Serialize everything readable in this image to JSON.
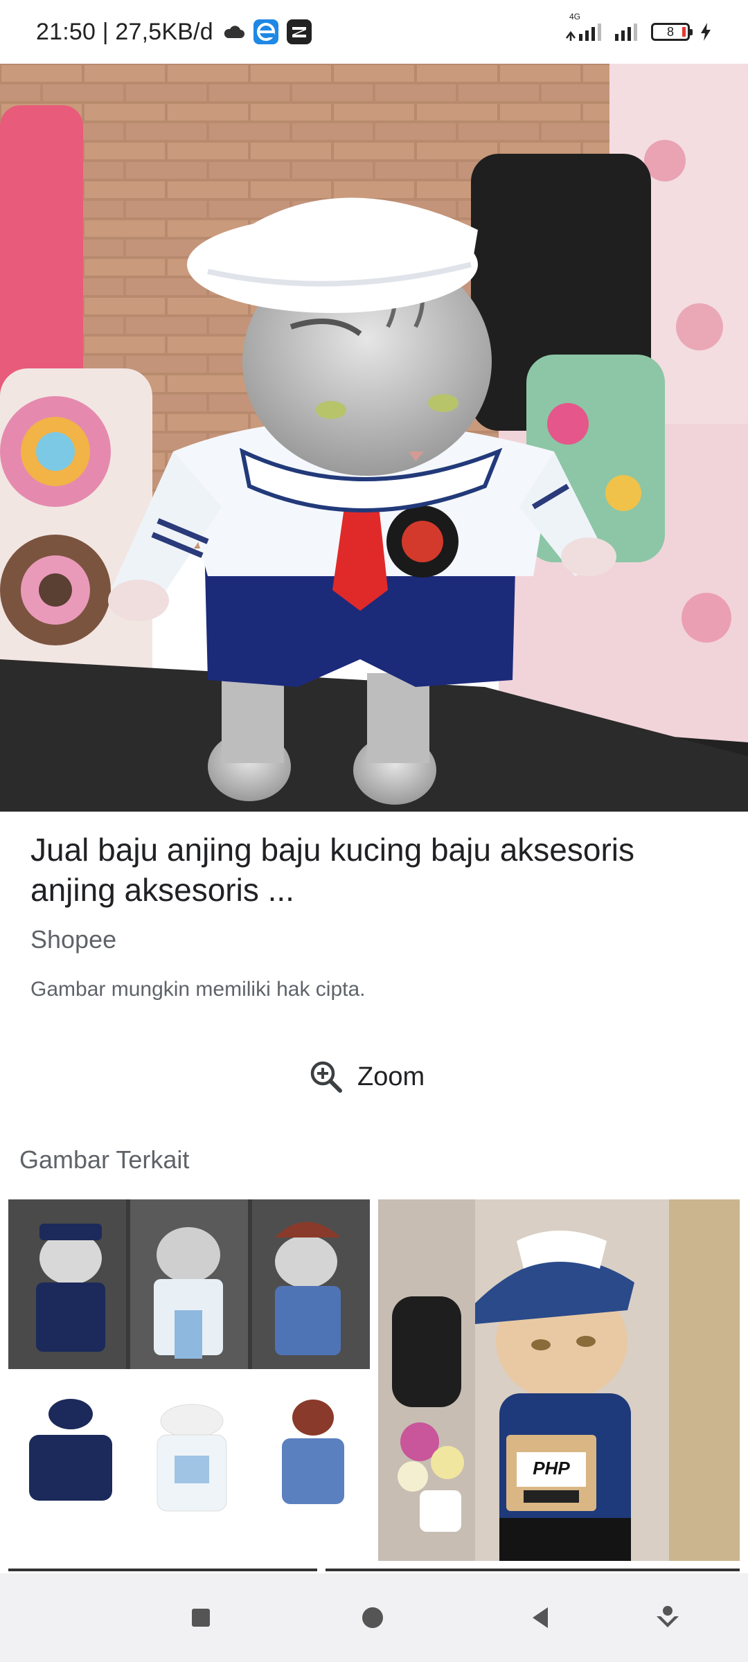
{
  "status_bar": {
    "time_speed": "21:50 | 27,5KB/d",
    "network_label": "4G",
    "battery_level": "8",
    "icons": [
      "cloud-icon",
      "browser-e-icon",
      "capcut-icon",
      "signal-icon",
      "signal-icon",
      "battery-icon",
      "charging-icon"
    ]
  },
  "result": {
    "title": "Jual baju anjing baju kucing baju aksesoris anjing aksesoris ...",
    "source": "Shopee",
    "copyright_note": "Gambar mungkin memiliki hak cipta."
  },
  "zoom": {
    "label": "Zoom",
    "icon": "zoom-in-icon"
  },
  "related": {
    "heading": "Gambar Terkait",
    "thumbs": [
      {
        "content": "cat costumes collage",
        "overlay_text": ""
      },
      {
        "content": "cat delivery costume",
        "overlay_text": "PHP"
      }
    ]
  },
  "nav_bar": {
    "buttons": [
      "recents-square-icon",
      "home-circle-icon",
      "back-triangle-icon",
      "assist-icon"
    ]
  },
  "colors": {
    "background": "#ffffff",
    "text_primary": "#202124",
    "text_secondary": "#5f6368",
    "nav_bar": "#f1f1f3",
    "battery_low": "#e53935",
    "browser_icon": "#1e88e5"
  }
}
